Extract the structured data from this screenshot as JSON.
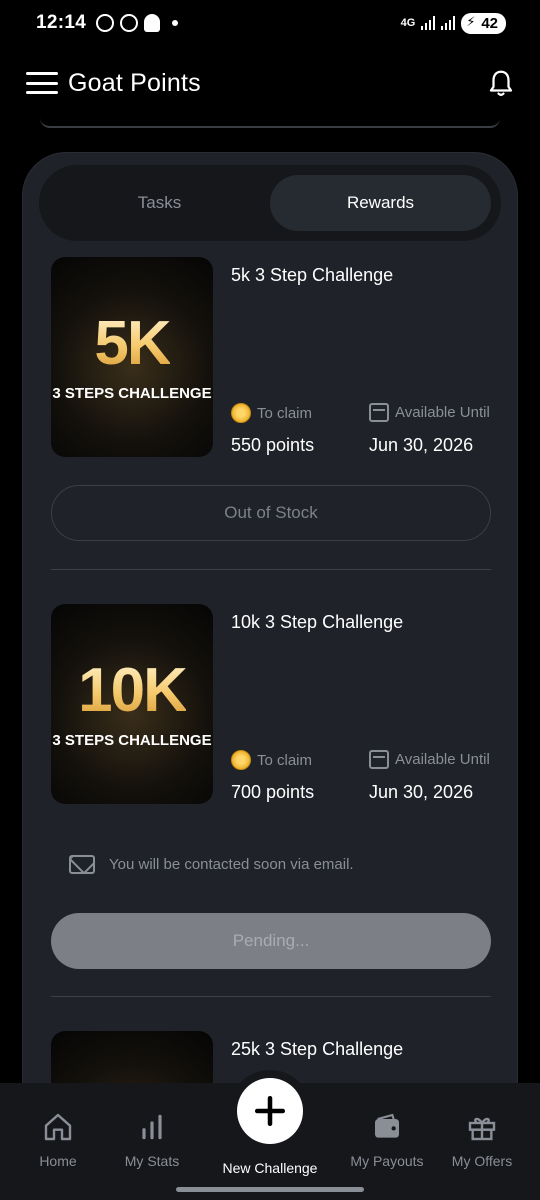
{
  "status_bar": {
    "time": "12:14",
    "network": "4G",
    "battery": "42"
  },
  "app_bar": {
    "title": "Goat Points"
  },
  "tabs": [
    {
      "label": "Tasks",
      "active": false
    },
    {
      "label": "Rewards",
      "active": true
    }
  ],
  "rewards": [
    {
      "thumb_big": "5K",
      "thumb_small": "3 STEPS CHALLENGE",
      "title": "5k 3 Step Challenge",
      "claim_label": "To claim",
      "points": "550 points",
      "available_label": "Available Until",
      "date": "Jun 30, 2026",
      "button": "Out of Stock"
    },
    {
      "thumb_big": "10K",
      "thumb_small": "3 STEPS CHALLENGE",
      "title": "10k 3 Step Challenge",
      "claim_label": "To claim",
      "points": "700 points",
      "available_label": "Available Until",
      "date": "Jun 30, 2026",
      "notice": "You will be contacted soon via email.",
      "button": "Pending..."
    },
    {
      "title": "25k 3 Step Challenge"
    }
  ],
  "bottom_nav": {
    "home": "Home",
    "stats": "My Stats",
    "new_challenge": "New Challenge",
    "payouts": "My Payouts",
    "offers": "My Offers"
  },
  "colors": {
    "background": "#000000",
    "card": "#1f2228",
    "accent_gold": "#f5c86a"
  }
}
